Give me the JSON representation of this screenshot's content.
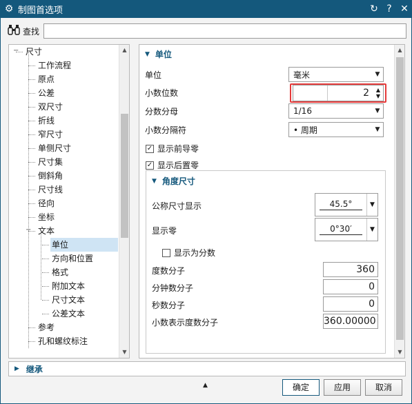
{
  "window": {
    "title": "制图首选项",
    "icons": {
      "app": "gear-icon",
      "reset": "reset-icon",
      "help": "help-icon",
      "close": "close-icon"
    }
  },
  "search": {
    "label": "查找",
    "value": "",
    "icon": "binoculars-icon"
  },
  "tree": {
    "items": [
      {
        "label": "尺寸",
        "level": 0,
        "expanded": true
      },
      {
        "label": "工作流程",
        "level": 1
      },
      {
        "label": "原点",
        "level": 1
      },
      {
        "label": "公差",
        "level": 1
      },
      {
        "label": "双尺寸",
        "level": 1
      },
      {
        "label": "折线",
        "level": 1
      },
      {
        "label": "窄尺寸",
        "level": 1
      },
      {
        "label": "单侧尺寸",
        "level": 1
      },
      {
        "label": "尺寸集",
        "level": 1
      },
      {
        "label": "倒斜角",
        "level": 1
      },
      {
        "label": "尺寸线",
        "level": 1
      },
      {
        "label": "径向",
        "level": 1
      },
      {
        "label": "坐标",
        "level": 1
      },
      {
        "label": "文本",
        "level": 1,
        "expanded": true
      },
      {
        "label": "单位",
        "level": 2,
        "selected": true
      },
      {
        "label": "方向和位置",
        "level": 2
      },
      {
        "label": "格式",
        "level": 2
      },
      {
        "label": "附加文本",
        "level": 2
      },
      {
        "label": "尺寸文本",
        "level": 2
      },
      {
        "label": "公差文本",
        "level": 2
      },
      {
        "label": "参考",
        "level": 1
      },
      {
        "label": "孔和螺纹标注",
        "level": 1
      }
    ]
  },
  "units_section": {
    "title": "单位",
    "unit_label": "单位",
    "unit_value": "毫米",
    "decimals_label": "小数位数",
    "decimals_value": "2",
    "fraction_label": "分数分母",
    "fraction_value": "1/16",
    "separator_label": "小数分隔符",
    "separator_value": "•  周期",
    "show_leading_zeros": "显示前导零",
    "show_leading_zeros_checked": true,
    "show_trailing_zeros": "显示后置零",
    "show_trailing_zeros_checked": true
  },
  "angle_section": {
    "title": "角度尺寸",
    "nominal_label": "公称尺寸显示",
    "nominal_value": "45.5°",
    "zero_label": "显示零",
    "zero_value": "0°30′",
    "as_fraction_label": "显示为分数",
    "as_fraction_checked": false,
    "degree_numerator_label": "度数分子",
    "degree_numerator_value": "360",
    "minute_numerator_label": "分钟数分子",
    "minute_numerator_value": "0",
    "second_numerator_label": "秒数分子",
    "second_numerator_value": "0",
    "decimal_numerator_label": "小数表示度数分子",
    "decimal_numerator_value": "360.00000"
  },
  "inherit": {
    "title": "继承"
  },
  "buttons": {
    "ok": "确定",
    "apply": "应用",
    "cancel": "取消"
  }
}
